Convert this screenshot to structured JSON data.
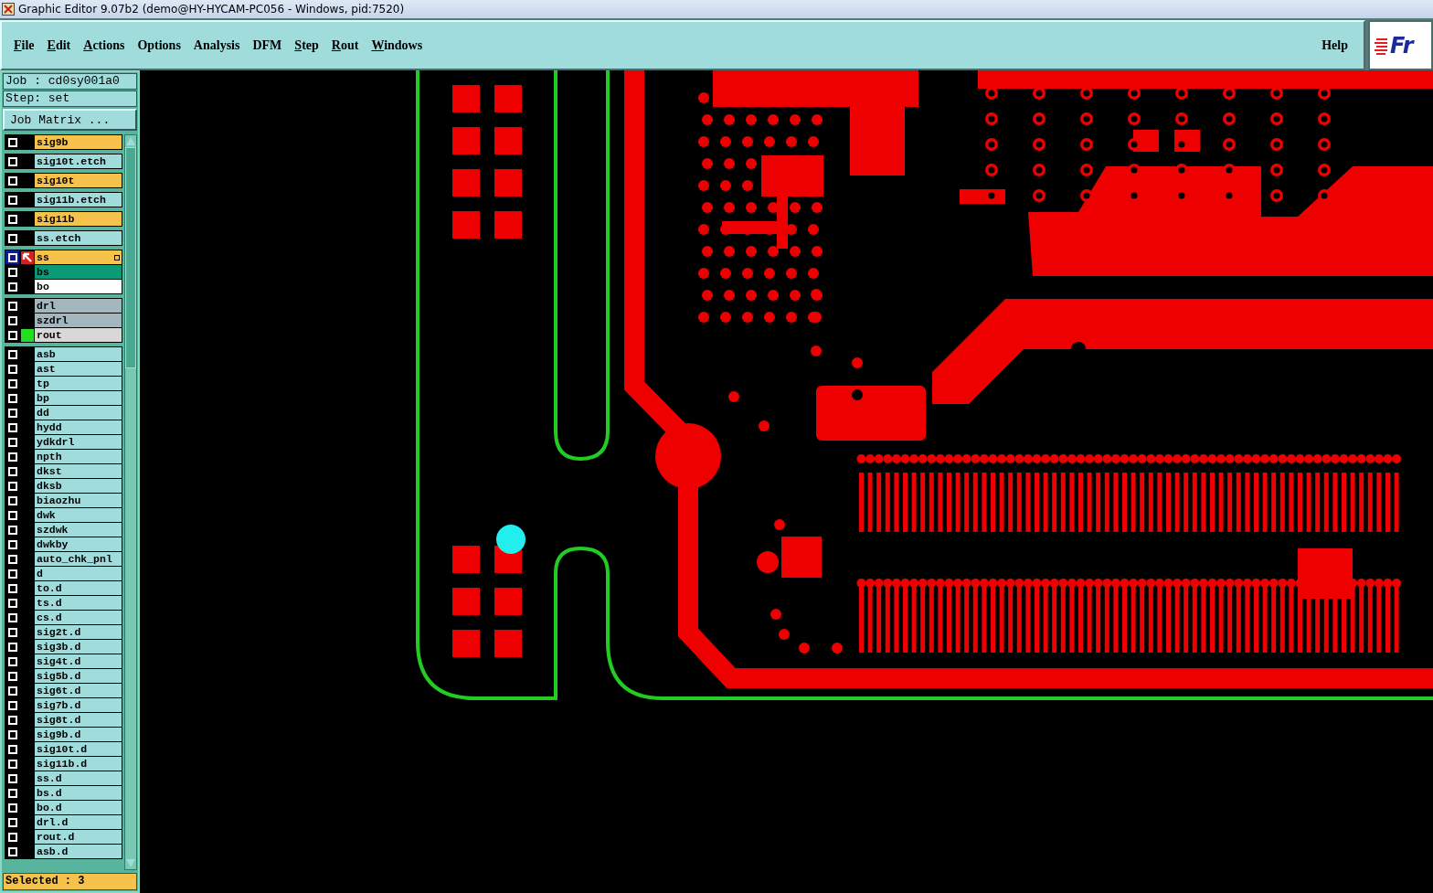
{
  "window": {
    "title": "Graphic Editor 9.07b2 (demo@HY-HYCAM-PC056 - Windows, pid:7520)"
  },
  "menu": [
    {
      "label": "File",
      "underlined": true
    },
    {
      "label": "Edit",
      "underlined": true
    },
    {
      "label": "Actions",
      "underlined": true
    },
    {
      "label": "Options",
      "underlined": false
    },
    {
      "label": "Analysis",
      "underlined": false
    },
    {
      "label": "DFM",
      "underlined": false
    },
    {
      "label": "Step",
      "underlined": true
    },
    {
      "label": "Rout",
      "underlined": true
    },
    {
      "label": "Windows",
      "underlined": true
    }
  ],
  "help": {
    "label": "Help"
  },
  "logo": {
    "text": "Fr"
  },
  "sidebar": {
    "job": "Job : cd0sy001a0",
    "step": "Step: set",
    "job_matrix_button": "Job Matrix ...",
    "selected_status": "Selected : 3"
  },
  "layer_groups": [
    [
      {
        "name": "sig9b",
        "color": "#f7c24c",
        "work": false
      }
    ],
    [
      {
        "name": "sig10t.etch",
        "color": "#a0dcdc",
        "work": false
      }
    ],
    [
      {
        "name": "sig10t",
        "color": "#f7c24c",
        "work": false
      }
    ],
    [
      {
        "name": "sig11b.etch",
        "color": "#a0dcdc",
        "work": false
      }
    ],
    [
      {
        "name": "sig11b",
        "color": "#f7c24c",
        "work": false
      }
    ],
    [
      {
        "name": "ss.etch",
        "color": "#a0dcdc",
        "work": false
      }
    ],
    [
      {
        "name": "ss",
        "color": "#f7c24c",
        "work": true
      },
      {
        "name": "bs",
        "color": "#0a9a78",
        "work": false
      },
      {
        "name": "bo",
        "color": "#ffffff",
        "work": false
      }
    ],
    [
      {
        "name": "drl",
        "color": "#a2b6be",
        "work": false
      },
      {
        "name": "szdrl",
        "color": "#a2b6be",
        "work": false
      },
      {
        "name": "rout",
        "color": "#d8d8d8",
        "work": false,
        "displayed": true
      }
    ],
    [
      {
        "name": "asb",
        "color": "#a0dcdc",
        "work": false
      },
      {
        "name": "ast",
        "color": "#a0dcdc",
        "work": false
      },
      {
        "name": "tp",
        "color": "#a0dcdc",
        "work": false
      },
      {
        "name": "bp",
        "color": "#a0dcdc",
        "work": false
      },
      {
        "name": "dd",
        "color": "#a0dcdc",
        "work": false
      },
      {
        "name": "hydd",
        "color": "#a0dcdc",
        "work": false
      },
      {
        "name": "ydkdrl",
        "color": "#a0dcdc",
        "work": false
      },
      {
        "name": "npth",
        "color": "#a0dcdc",
        "work": false
      },
      {
        "name": "dkst",
        "color": "#a0dcdc",
        "work": false
      },
      {
        "name": "dksb",
        "color": "#a0dcdc",
        "work": false
      },
      {
        "name": "biaozhu",
        "color": "#a0dcdc",
        "work": false
      },
      {
        "name": "dwk",
        "color": "#a0dcdc",
        "work": false
      },
      {
        "name": "szdwk",
        "color": "#a0dcdc",
        "work": false
      },
      {
        "name": "dwkby",
        "color": "#a0dcdc",
        "work": false
      },
      {
        "name": "auto_chk_pnl",
        "color": "#a0dcdc",
        "work": false
      },
      {
        "name": "d",
        "color": "#a0dcdc",
        "work": false
      },
      {
        "name": "to.d",
        "color": "#a0dcdc",
        "work": false
      },
      {
        "name": "ts.d",
        "color": "#a0dcdc",
        "work": false
      },
      {
        "name": "cs.d",
        "color": "#a0dcdc",
        "work": false
      },
      {
        "name": "sig2t.d",
        "color": "#a0dcdc",
        "work": false
      },
      {
        "name": "sig3b.d",
        "color": "#a0dcdc",
        "work": false
      },
      {
        "name": "sig4t.d",
        "color": "#a0dcdc",
        "work": false
      },
      {
        "name": "sig5b.d",
        "color": "#a0dcdc",
        "work": false
      },
      {
        "name": "sig6t.d",
        "color": "#a0dcdc",
        "work": false
      },
      {
        "name": "sig7b.d",
        "color": "#a0dcdc",
        "work": false
      },
      {
        "name": "sig8t.d",
        "color": "#a0dcdc",
        "work": false
      },
      {
        "name": "sig9b.d",
        "color": "#a0dcdc",
        "work": false
      },
      {
        "name": "sig10t.d",
        "color": "#a0dcdc",
        "work": false
      },
      {
        "name": "sig11b.d",
        "color": "#a0dcdc",
        "work": false
      },
      {
        "name": "ss.d",
        "color": "#a0dcdc",
        "work": false
      },
      {
        "name": "bs.d",
        "color": "#a0dcdc",
        "work": false
      },
      {
        "name": "bo.d",
        "color": "#a0dcdc",
        "work": false
      },
      {
        "name": "drl.d",
        "color": "#a0dcdc",
        "work": false
      },
      {
        "name": "rout.d",
        "color": "#a0dcdc",
        "work": false
      },
      {
        "name": "asb.d",
        "color": "#a0dcdc",
        "work": false
      }
    ]
  ]
}
